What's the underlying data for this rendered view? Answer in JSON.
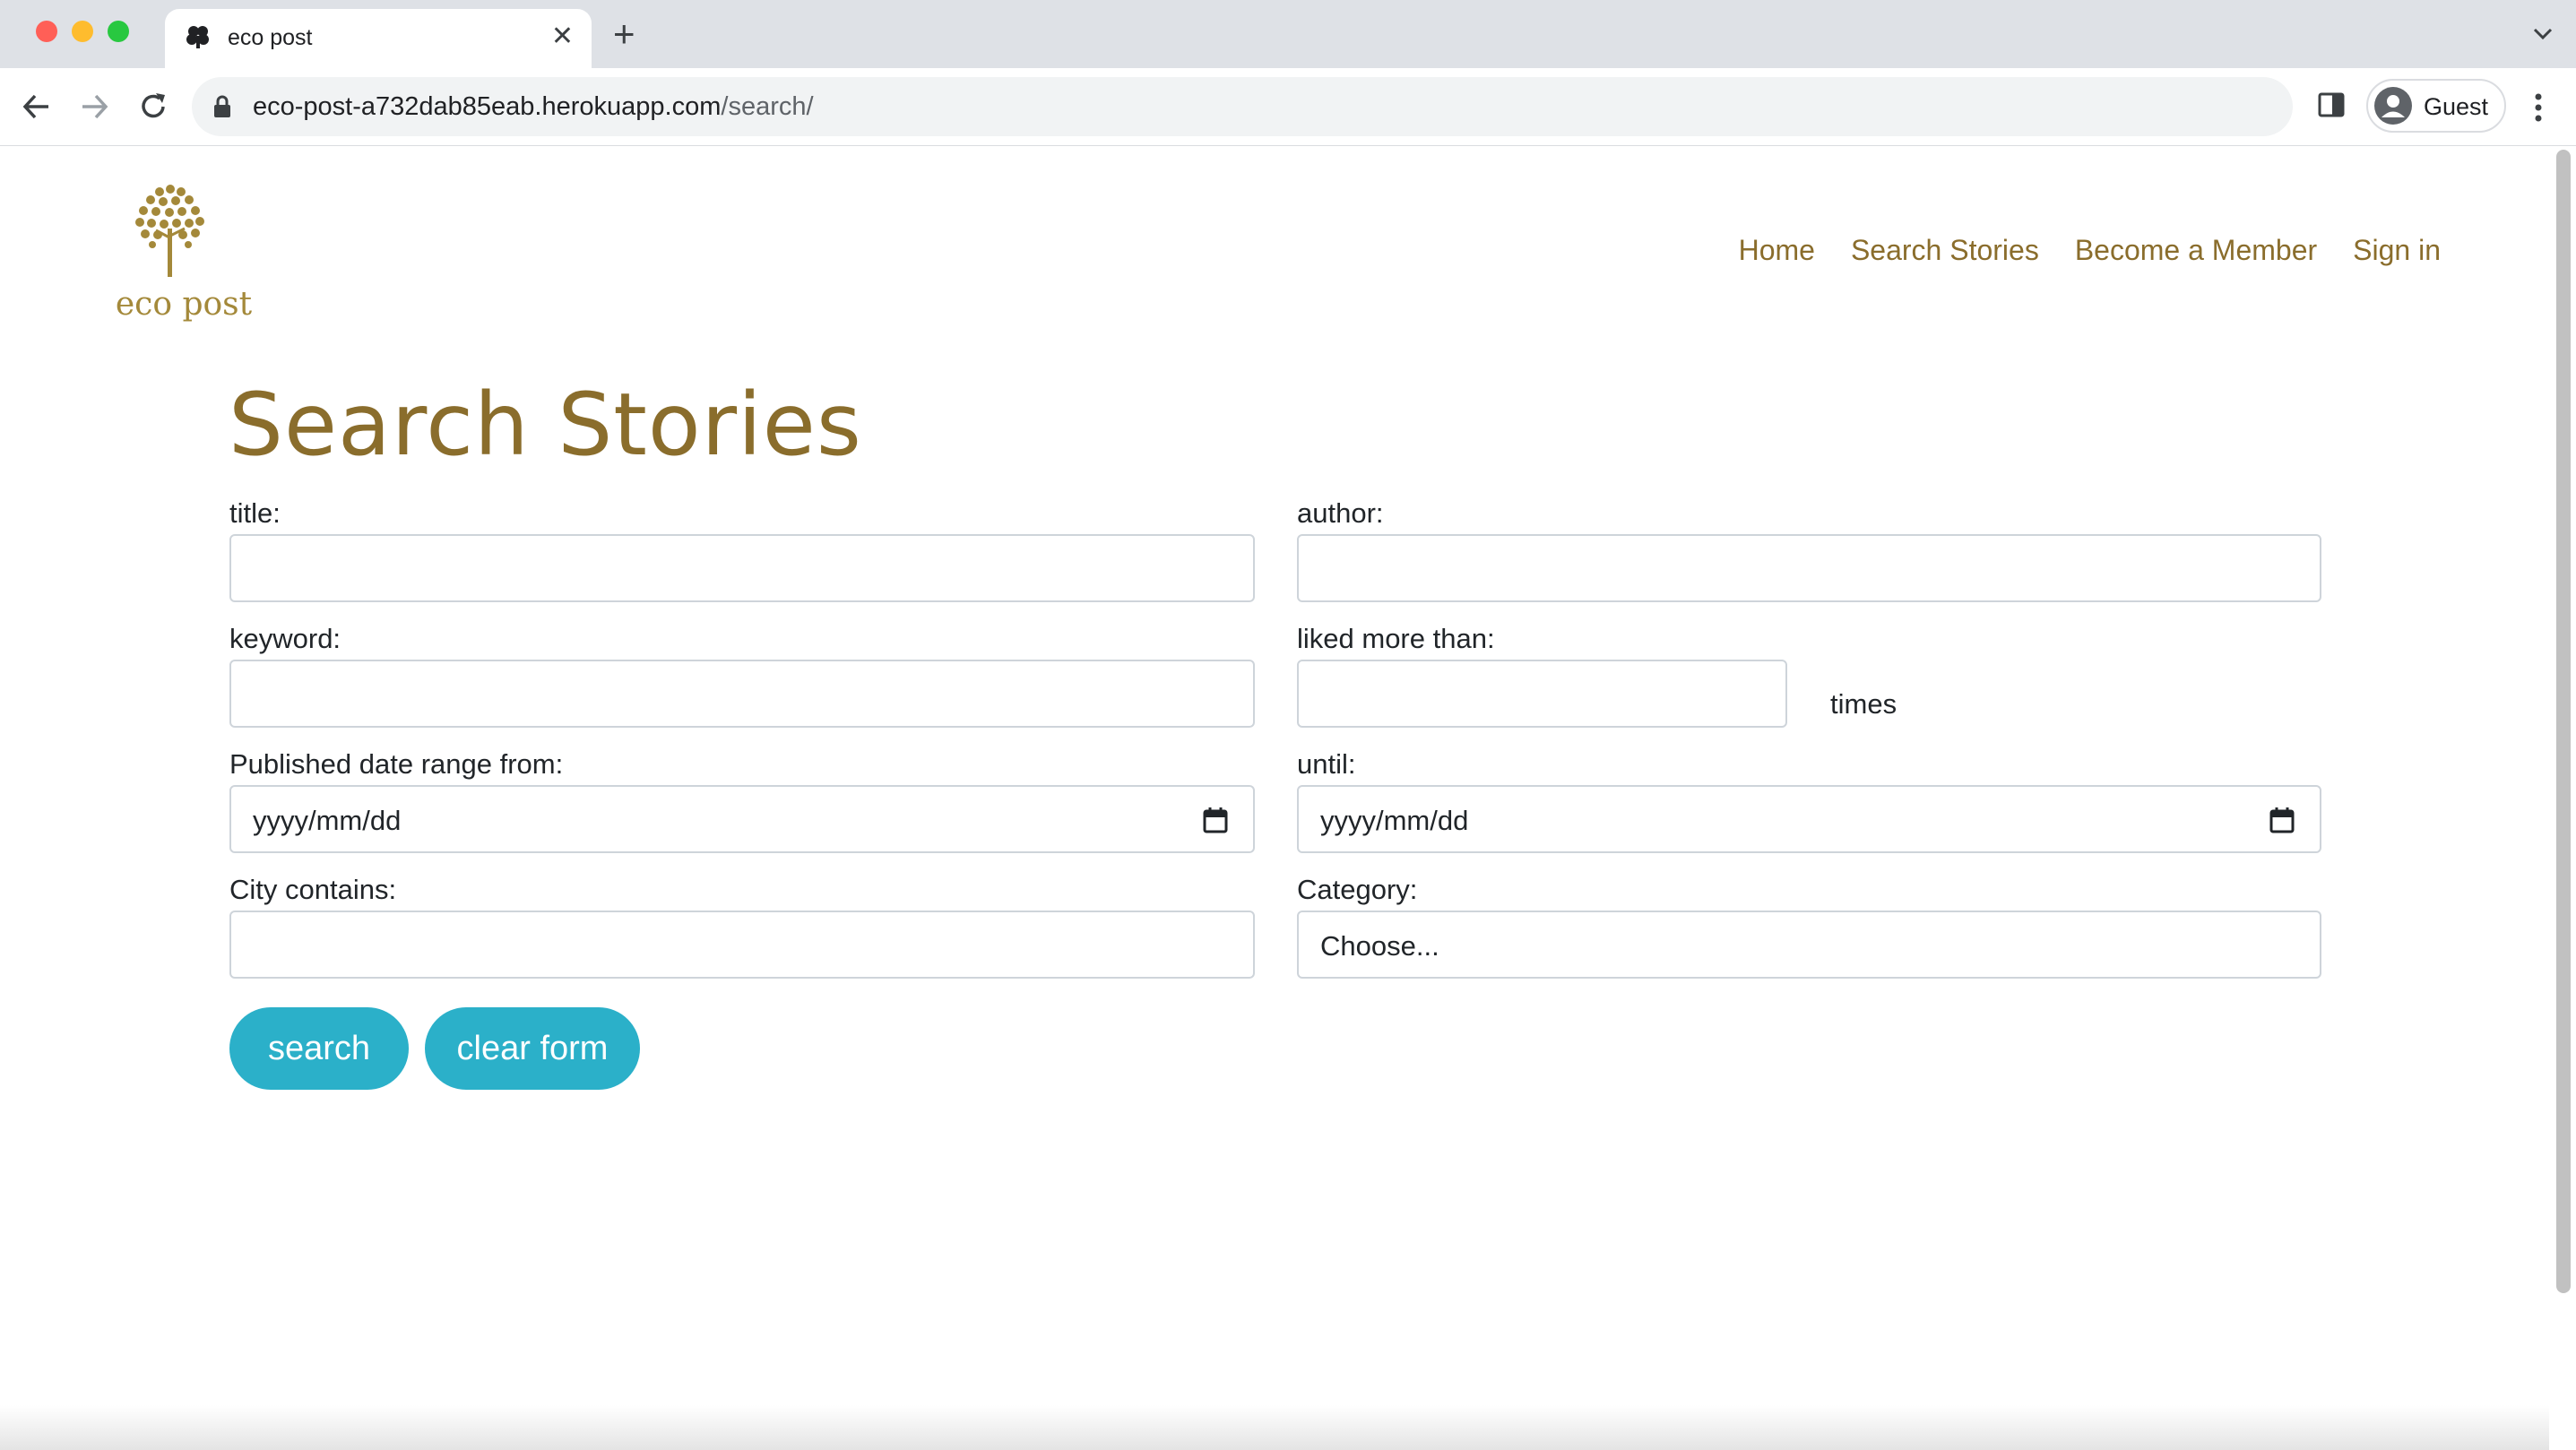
{
  "browser": {
    "tab_title": "eco post",
    "url_host": "eco-post-a732dab85eab.herokuapp.com",
    "url_path": "/search/",
    "profile_name": "Guest"
  },
  "site": {
    "logo_text": "eco post",
    "brand_color": "#8a6d2c",
    "accent_color": "#2bb0c9",
    "nav": [
      "Home",
      "Search Stories",
      "Become a Member",
      "Sign in"
    ]
  },
  "search_form": {
    "title": "Search Stories",
    "title_label": "title:",
    "author_label": "author:",
    "keyword_label": "keyword:",
    "liked_label": "liked more than:",
    "times_label": "times",
    "date_from_label": "Published date range from:",
    "date_from_placeholder": "yyyy/mm/dd",
    "until_label": "until:",
    "until_placeholder": "yyyy/mm/dd",
    "city_label": "City contains:",
    "category_label": "Category:",
    "category_selected": "Choose...",
    "search_button": "search",
    "clear_button": "clear form"
  }
}
